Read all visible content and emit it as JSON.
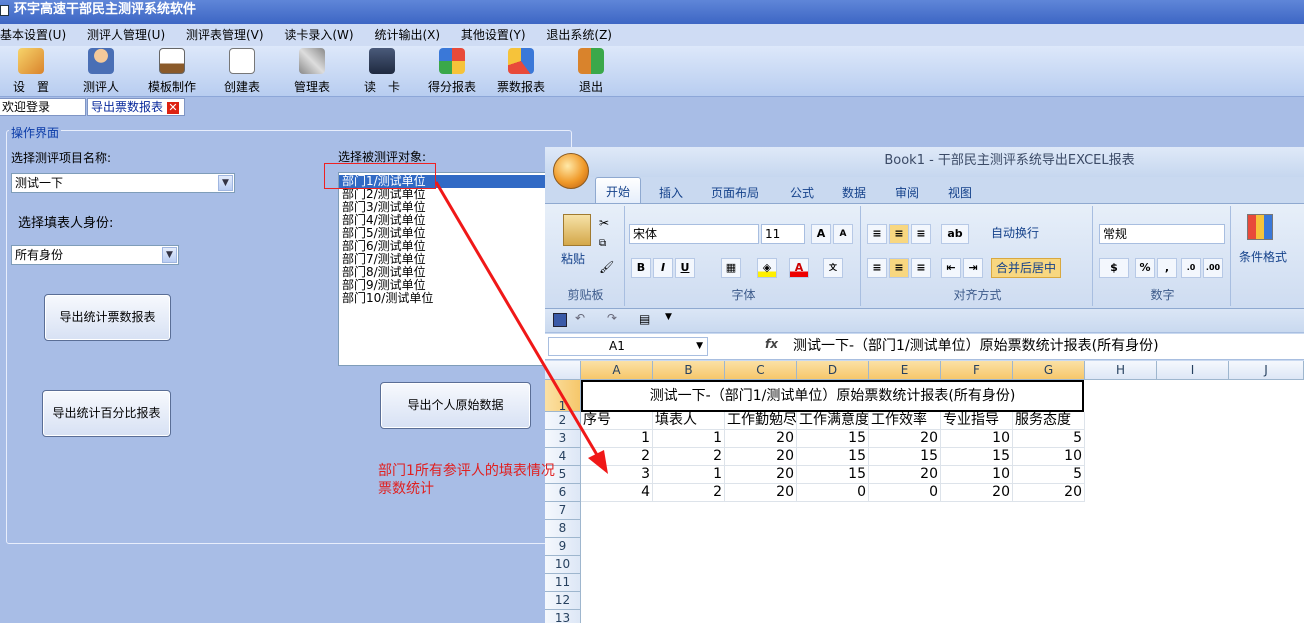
{
  "app": {
    "title": "环宇高速干部民主测评系统软件"
  },
  "menu": [
    "基本设置(U)",
    "测评人管理(U)",
    "测评表管理(V)",
    "读卡录入(W)",
    "统计输出(X)",
    "其他设置(Y)",
    "退出系统(Z)"
  ],
  "toolbar": [
    {
      "label": "设　置",
      "icon": "settings-icon"
    },
    {
      "label": "测评人",
      "icon": "user-icon"
    },
    {
      "label": "模板制作",
      "icon": "template-icon"
    },
    {
      "label": "创建表",
      "icon": "create-table-icon"
    },
    {
      "label": "管理表",
      "icon": "tools-icon"
    },
    {
      "label": "读　卡",
      "icon": "card-reader-icon"
    },
    {
      "label": "得分报表",
      "icon": "score-report-icon"
    },
    {
      "label": "票数报表",
      "icon": "vote-report-icon"
    },
    {
      "label": "退出",
      "icon": "exit-icon"
    }
  ],
  "tabs": {
    "welcome": "欢迎登录",
    "active": "导出票数报表"
  },
  "panel": {
    "title": "操作界面",
    "project_label": "选择测评项目名称:",
    "project_value": "测试一下",
    "role_label": "选择填表人身份:",
    "role_value": "所有身份",
    "target_label": "选择被测评对象:",
    "btn_export_votes": "导出统计票数报表",
    "btn_export_percent": "导出统计百分比报表",
    "btn_export_raw": "导出个人原始数据",
    "targets": [
      "部门1/测试单位",
      "部门2/测试单位",
      "部门3/测试单位",
      "部门4/测试单位",
      "部门5/测试单位",
      "部门6/测试单位",
      "部门7/测试单位",
      "部门8/测试单位",
      "部门9/测试单位",
      "部门10/测试单位"
    ]
  },
  "annotation": {
    "line1": "部门1所有参评人的填表情况",
    "line2": "票数统计"
  },
  "excel": {
    "title": "Book1 - 干部民主测评系统导出EXCEL报表",
    "ribbon_tabs": [
      "开始",
      "插入",
      "页面布局",
      "公式",
      "数据",
      "审阅",
      "视图"
    ],
    "font_name": "宋体",
    "font_size": "11",
    "wrap_label": "自动换行",
    "merge_label": "合并后居中",
    "number_format": "常规",
    "paste_label": "粘贴",
    "cond_format_label": "条件格式",
    "groups": [
      "剪贴板",
      "字体",
      "对齐方式",
      "数字"
    ],
    "name_box": "A1",
    "fx": "fx",
    "formula": "测试一下-（部门1/测试单位）原始票数统计报表(所有身份)",
    "columns": [
      "A",
      "B",
      "C",
      "D",
      "E",
      "F",
      "G",
      "H",
      "I",
      "J"
    ],
    "rows": [
      "1",
      "2",
      "3",
      "4",
      "5",
      "6",
      "7",
      "8",
      "9",
      "10",
      "11",
      "12",
      "13"
    ],
    "merged_title": "测试一下-（部门1/测试单位）原始票数统计报表(所有身份)",
    "header_row": [
      "序号",
      "填表人",
      "工作勤勉尽",
      "工作满意度",
      "工作效率",
      "专业指导",
      "服务态度"
    ],
    "data_rows": [
      [
        "1",
        "1",
        "20",
        "15",
        "20",
        "10",
        "5"
      ],
      [
        "2",
        "2",
        "20",
        "15",
        "15",
        "15",
        "10"
      ],
      [
        "3",
        "1",
        "20",
        "15",
        "20",
        "10",
        "5"
      ],
      [
        "4",
        "2",
        "20",
        "0",
        "0",
        "20",
        "20"
      ]
    ]
  }
}
